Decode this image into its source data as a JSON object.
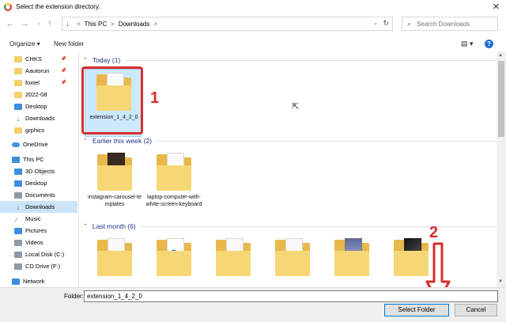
{
  "window": {
    "title": "Select the extension directory."
  },
  "address": {
    "crumbs": [
      "This PC",
      "Downloads"
    ],
    "separator": ">"
  },
  "search": {
    "placeholder": "Search Downloads"
  },
  "toolbar": {
    "organize": "Organize",
    "new_folder": "New folder"
  },
  "sidebar": {
    "items": [
      {
        "label": "CHKS",
        "icon": "folder-icon",
        "pinned": true
      },
      {
        "label": "Aautorun",
        "icon": "folder-icon",
        "pinned": true
      },
      {
        "label": "foxtel",
        "icon": "folder-icon",
        "pinned": true
      },
      {
        "label": "2022-08",
        "icon": "folder-icon",
        "pinned": false
      },
      {
        "label": "Desktop",
        "icon": "desktop-icon",
        "pinned": false
      },
      {
        "label": "Downloads",
        "icon": "download-icon",
        "pinned": false
      },
      {
        "label": "grphics",
        "icon": "folder-icon",
        "pinned": false
      },
      {
        "label": "OneDrive",
        "icon": "cloud-icon",
        "pinned": false
      },
      {
        "label": "This PC",
        "icon": "pc-icon",
        "pinned": false
      },
      {
        "label": "3D Objects",
        "icon": "cube-icon",
        "pinned": false
      },
      {
        "label": "Desktop",
        "icon": "desktop-icon",
        "pinned": false
      },
      {
        "label": "Documents",
        "icon": "documents-icon",
        "pinned": false
      },
      {
        "label": "Downloads",
        "icon": "download-icon",
        "pinned": false
      },
      {
        "label": "Music",
        "icon": "music-icon",
        "pinned": false
      },
      {
        "label": "Pictures",
        "icon": "pictures-icon",
        "pinned": false
      },
      {
        "label": "Videos",
        "icon": "videos-icon",
        "pinned": false
      },
      {
        "label": "Local Disk (C:)",
        "icon": "disk-icon",
        "pinned": false
      },
      {
        "label": "CD Drive (F:)",
        "icon": "cd-drive-icon",
        "pinned": false
      },
      {
        "label": "Network",
        "icon": "network-icon",
        "pinned": false
      }
    ]
  },
  "groups": {
    "today": "Today (1)",
    "earlier": "Earlier this week (2)",
    "lastmonth": "Last month (6)"
  },
  "files": {
    "today": [
      {
        "name": "extension_1_4_2_0"
      }
    ],
    "earlier": [
      {
        "name": "instagram-carousel-templates"
      },
      {
        "name": "laptop-computer-with-white-screen-keyboard"
      }
    ]
  },
  "annotations": {
    "one": "1",
    "two": "2"
  },
  "footer": {
    "folder_label": "Folder:",
    "folder_value": "extension_1_4_2_0",
    "select": "Select Folder",
    "cancel": "Cancel"
  },
  "colors": {
    "accent": "#0078d7",
    "annotation": "#d92d2d",
    "selection": "#cce8ff"
  }
}
